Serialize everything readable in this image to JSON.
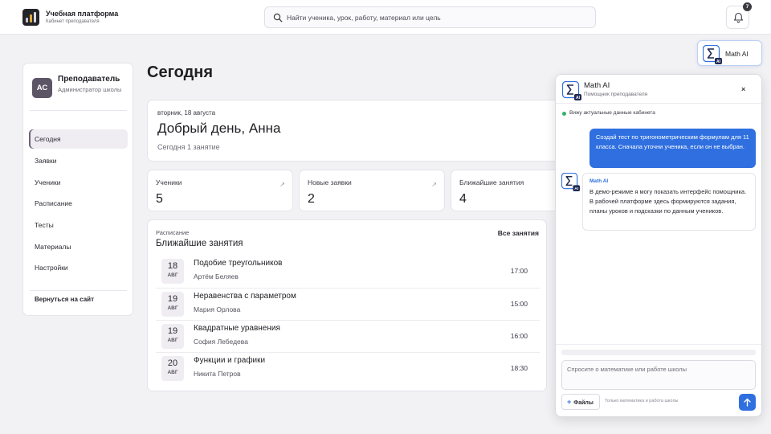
{
  "brand": {
    "title": "Учебная платформа",
    "subtitle": "Кабинет преподавателя"
  },
  "search": {
    "placeholder": "Найти ученика, урок, работу, материал или цель"
  },
  "notifications": {
    "count": "7"
  },
  "profile": {
    "initials": "АС",
    "name": "Преподаватель",
    "role": "Администратор школы"
  },
  "nav": {
    "items": [
      {
        "label": "Сегодня",
        "active": true
      },
      {
        "label": "Заявки"
      },
      {
        "label": "Ученики"
      },
      {
        "label": "Расписание"
      },
      {
        "label": "Тесты"
      },
      {
        "label": "Материалы"
      },
      {
        "label": "Настройки"
      }
    ],
    "back": "Вернуться на сайт"
  },
  "page": {
    "title": "Сегодня"
  },
  "greeting": {
    "date": "вторник, 18 августа",
    "hello": "Добрый день, Анна",
    "summary": "Сегодня 1 занятие"
  },
  "stats": [
    {
      "label": "Ученики",
      "value": "5"
    },
    {
      "label": "Новые заявки",
      "value": "2"
    },
    {
      "label": "Ближайшие занятия",
      "value": "4"
    }
  ],
  "schedule": {
    "label": "Расписание",
    "title": "Ближайшие занятия",
    "all_link": "Все занятия",
    "items": [
      {
        "day": "18",
        "month": "АВГ",
        "title": "Подобие треугольников",
        "student": "Артём Беляев",
        "time": "17:00"
      },
      {
        "day": "19",
        "month": "АВГ",
        "title": "Неравенства с параметром",
        "student": "Мария Орлова",
        "time": "15:00"
      },
      {
        "day": "19",
        "month": "АВГ",
        "title": "Квадратные уравнения",
        "student": "София Лебедева",
        "time": "16:00"
      },
      {
        "day": "20",
        "month": "АВГ",
        "title": "Функции и графики",
        "student": "Никита Петров",
        "time": "18:30"
      }
    ]
  },
  "math_ai": {
    "launcher_label": "Math AI",
    "title": "Math AI",
    "subtitle": "Помощник преподавателя",
    "close": "×",
    "status": "Вижу актуальные данные кабинета",
    "user_message": "Создай тест по тригонометрическим формулам для 11 класса. Сначала уточни ученика, если он не выбран.",
    "bot_name": "Math AI",
    "bot_message": "В демо-режиме я могу показать интерфейс помощника. В рабочей платформе здесь формируются задания, планы уроков и подсказки по данным учеников.",
    "input_placeholder": "Спросите о математике или работе школы",
    "files_label": "Файлы",
    "hint": "Только математика и работа школы",
    "badge": "AI"
  },
  "colors": {
    "accent": "#2f6fe0",
    "status_online": "#2fb56a",
    "avatar": "#5c5566"
  }
}
